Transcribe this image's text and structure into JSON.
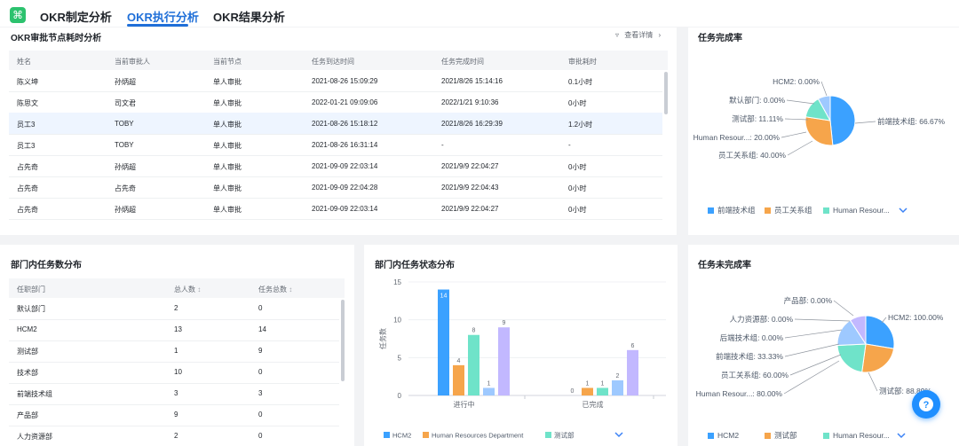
{
  "tabs": [
    "OKR制定分析",
    "OKR执行分析",
    "OKR结果分析"
  ],
  "approval": {
    "title": "OKR审批节点耗时分析",
    "details_label": "查看详情",
    "columns": [
      "姓名",
      "当前审批人",
      "当前节点",
      "任务到达时间",
      "任务完成时间",
      "审批耗时"
    ],
    "rows": [
      [
        "陈义坤",
        "孙炳超",
        "单人审批",
        "2021-08-26 15:09:29",
        "2021/8/26 15:14:16",
        "0.1小时"
      ],
      [
        "陈思文",
        "司文君",
        "单人审批",
        "2022-01-21 09:09:06",
        "2022/1/21 9:10:36",
        "0小时"
      ],
      [
        "员工3",
        "TOBY",
        "单人审批",
        "2021-08-26 15:18:12",
        "2021/8/26 16:29:39",
        "1.2小时"
      ],
      [
        "员工3",
        "TOBY",
        "单人审批",
        "2021-08-26 16:31:14",
        "-",
        "-"
      ],
      [
        "占先奇",
        "孙炳超",
        "单人审批",
        "2021-09-09 22:03:14",
        "2021/9/9 22:04:27",
        "0小时"
      ],
      [
        "占先奇",
        "占先奇",
        "单人审批",
        "2021-09-09 22:04:28",
        "2021/9/9 22:04:43",
        "0小时"
      ],
      [
        "占先奇",
        "孙炳超",
        "单人审批",
        "2021-09-09 22:03:14",
        "2021/9/9 22:04:27",
        "0小时"
      ]
    ]
  },
  "dept": {
    "title": "部门内任务数分布",
    "columns": [
      "任职部门",
      "总人数",
      "任务总数"
    ],
    "rows": [
      [
        "默认部门",
        "2",
        "0"
      ],
      [
        "HCM2",
        "13",
        "14"
      ],
      [
        "测试部",
        "1",
        "9"
      ],
      [
        "技术部",
        "10",
        "0"
      ],
      [
        "前端技术组",
        "3",
        "3"
      ],
      [
        "产品部",
        "9",
        "0"
      ],
      [
        "人力资源部",
        "2",
        "0"
      ]
    ]
  },
  "completion": {
    "title": "任务完成率",
    "legend": [
      "前端技术组",
      "员工关系组",
      "Human Resour..."
    ],
    "legend_colors": [
      "#3ba1ff",
      "#f6a54b",
      "#6fe3c9"
    ],
    "chart_data": {
      "type": "pie",
      "slices": [
        {
          "label": "前端技术组: 66.67%",
          "value": 66.67,
          "color": "#3ba1ff"
        },
        {
          "label": "员工关系组: 40.00%",
          "value": 40.0,
          "color": "#f6a54b"
        },
        {
          "label": "Human Resour...: 20.00%",
          "value": 20.0,
          "color": "#6fe3c9"
        },
        {
          "label": "测试部: 11.11%",
          "value": 11.11,
          "color": "#9ec9ff"
        },
        {
          "label": "默认部门: 0.00%",
          "value": 0,
          "color": "#c2b8ff"
        },
        {
          "label": "HCM2: 0.00%",
          "value": 0,
          "color": "#7ad9ff"
        }
      ]
    }
  },
  "status_dist": {
    "title": "部门内任务状态分布",
    "chart_data": {
      "type": "bar",
      "ylabel": "任务数",
      "ylim": [
        0,
        15
      ],
      "yticks": [
        0,
        5,
        10,
        15
      ],
      "categories": [
        "进行中",
        "已完成"
      ],
      "series": [
        {
          "name": "HCM2",
          "color": "#3ba1ff",
          "values": [
            14,
            0
          ]
        },
        {
          "name": "Human Resources Department",
          "color": "#f6a54b",
          "values": [
            4,
            1
          ]
        },
        {
          "name": "测试部",
          "color": "#6fe3c9",
          "values": [
            8,
            1
          ]
        },
        {
          "color": "#9ec9ff",
          "values": [
            1,
            2
          ]
        },
        {
          "color": "#c2b8ff",
          "values": [
            9,
            6
          ]
        }
      ]
    }
  },
  "incomplete": {
    "title": "任务未完成率",
    "legend": [
      "HCM2",
      "测试部",
      "Human Resour..."
    ],
    "legend_colors": [
      "#3ba1ff",
      "#f6a54b",
      "#6fe3c9"
    ],
    "chart_data": {
      "type": "pie",
      "slices": [
        {
          "label": "HCM2: 100.00%",
          "value": 100.0,
          "color": "#3ba1ff"
        },
        {
          "label": "测试部: 88.89%",
          "value": 88.89,
          "color": "#f6a54b"
        },
        {
          "label": "Human Resour...: 80.00%",
          "value": 80.0,
          "color": "#6fe3c9"
        },
        {
          "label": "员工关系组: 60.00%",
          "value": 60.0,
          "color": "#9ec9ff"
        },
        {
          "label": "前端技术组: 33.33%",
          "value": 33.33,
          "color": "#c2b8ff"
        },
        {
          "label": "后端技术组: 0.00%",
          "value": 0,
          "color": "#7ad9ff"
        },
        {
          "label": "人力资源部: 0.00%",
          "value": 0,
          "color": "#ffc8a0"
        },
        {
          "label": "产品部: 0.00%",
          "value": 0,
          "color": "#b7e6a9"
        }
      ]
    }
  }
}
